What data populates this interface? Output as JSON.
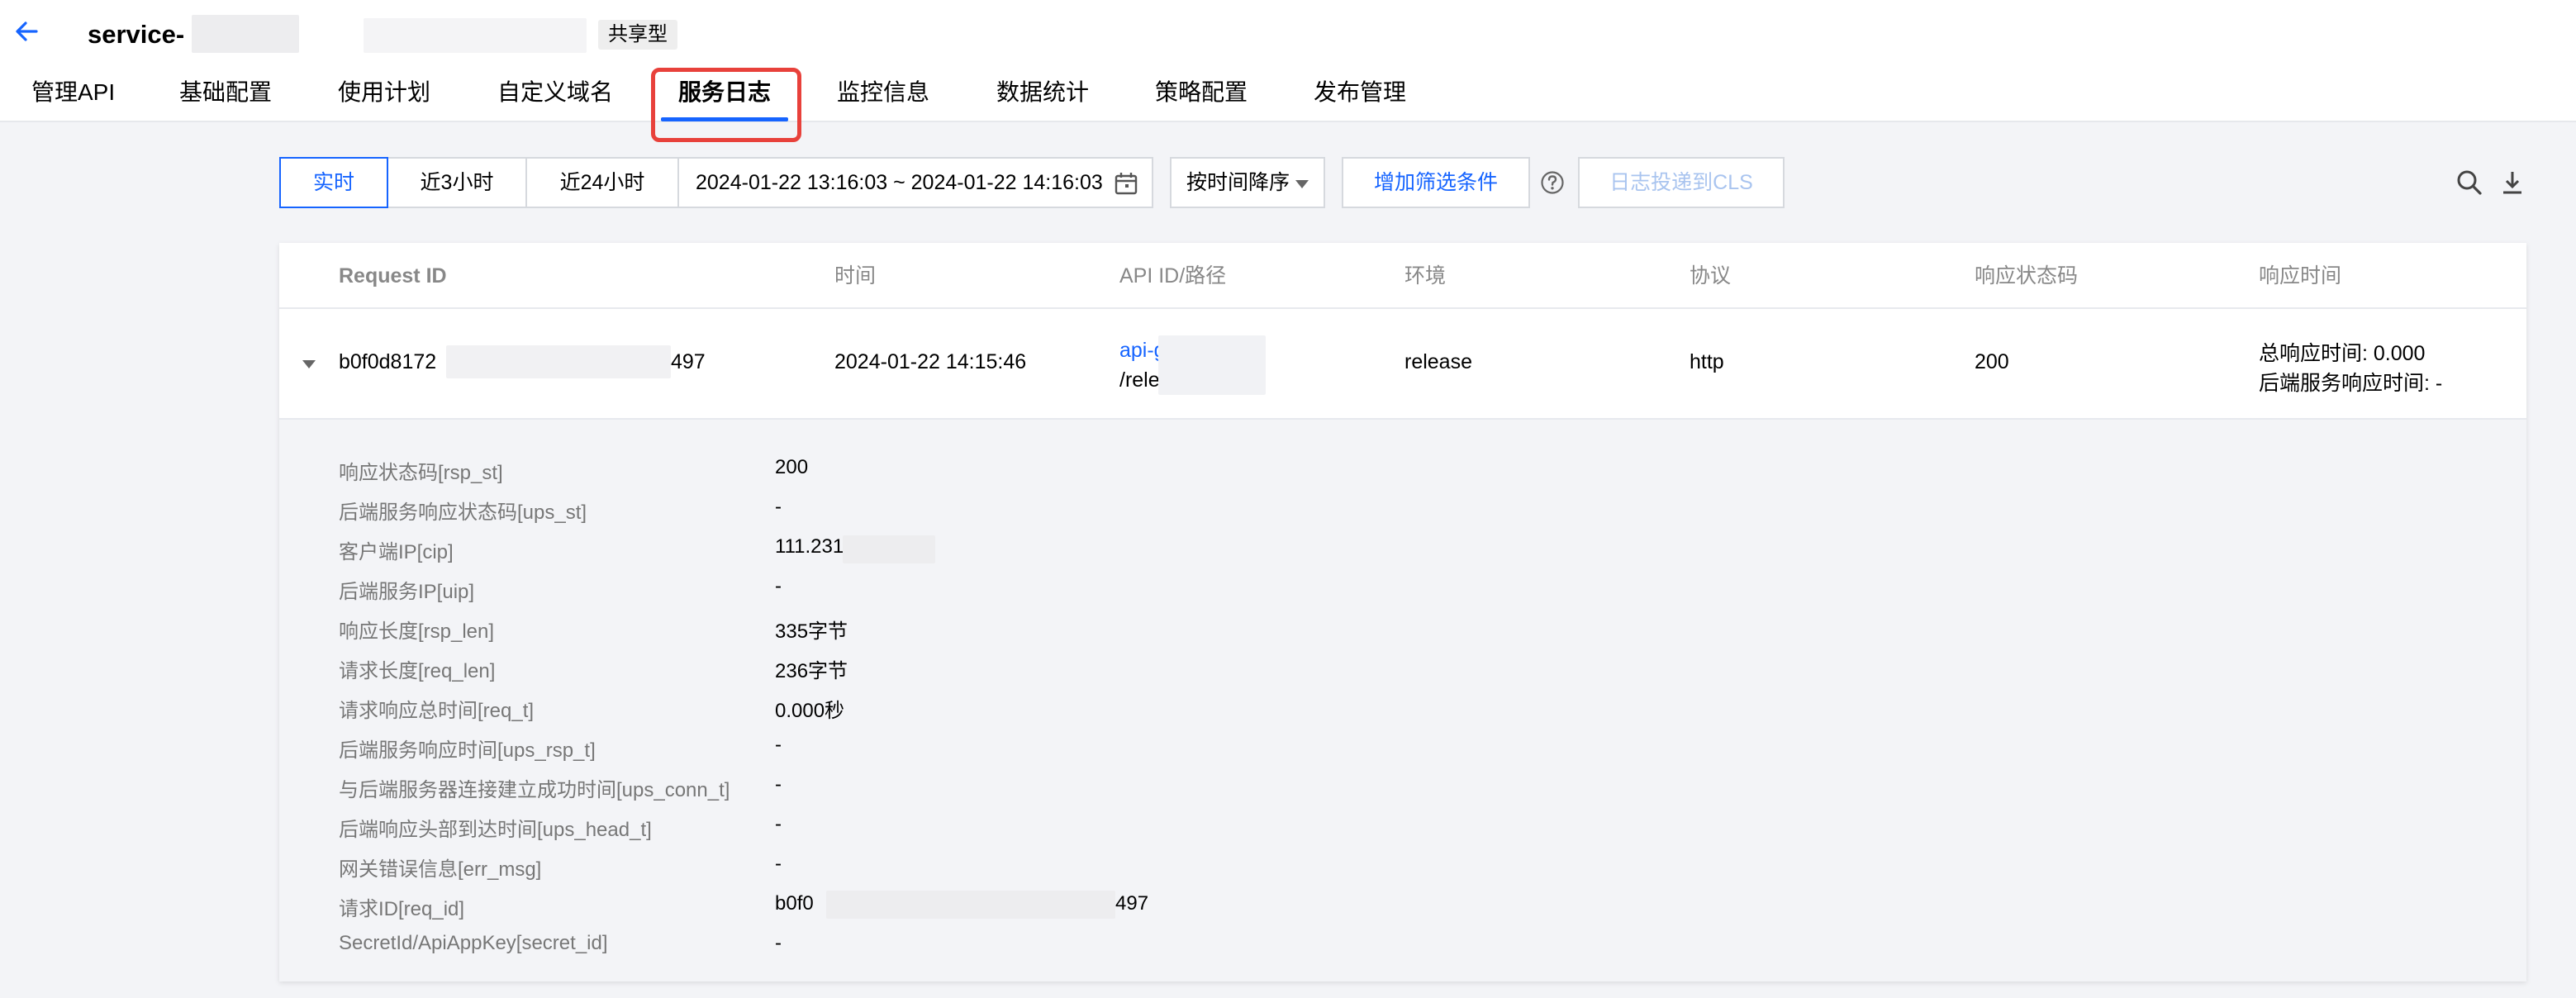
{
  "header": {
    "service_title": "service-",
    "badge": "共享型"
  },
  "tabs": [
    {
      "label": "管理API",
      "active": false
    },
    {
      "label": "基础配置",
      "active": false
    },
    {
      "label": "使用计划",
      "active": false
    },
    {
      "label": "自定义域名",
      "active": false
    },
    {
      "label": "服务日志",
      "active": true
    },
    {
      "label": "监控信息",
      "active": false
    },
    {
      "label": "数据统计",
      "active": false
    },
    {
      "label": "策略配置",
      "active": false
    },
    {
      "label": "发布管理",
      "active": false
    }
  ],
  "toolbar": {
    "time_ranges": [
      {
        "label": "实时",
        "active": true
      },
      {
        "label": "近3小时",
        "active": false
      },
      {
        "label": "近24小时",
        "active": false
      }
    ],
    "date_range": "2024-01-22 13:16:03 ~ 2024-01-22 14:16:03",
    "sort_select": "按时间降序",
    "add_filter_label": "增加筛选条件",
    "ship_to_cls_label": "日志投递到CLS",
    "icons": {
      "help": "help-circle-icon",
      "search": "search-icon",
      "download": "download-icon",
      "calendar": "calendar-icon"
    }
  },
  "table": {
    "columns": [
      "Request ID",
      "时间",
      "API ID/路径",
      "环境",
      "协议",
      "响应状态码",
      "响应时间"
    ],
    "row": {
      "request_id_prefix": "b0f0d8172",
      "request_id_suffix": "497",
      "time": "2024-01-22 14:15:46",
      "api_id": "api-g",
      "api_path": "/relea",
      "environment": "release",
      "protocol": "http",
      "status_code": "200",
      "total_response_time": "总响应时间: 0.000",
      "backend_response_time": "后端服务响应时间: -"
    },
    "details": [
      {
        "label": "响应状态码[rsp_st]",
        "value": "200"
      },
      {
        "label": "后端服务响应状态码[ups_st]",
        "value": "-"
      },
      {
        "label": "客户端IP[cip]",
        "value": "111.231."
      },
      {
        "label": "后端服务IP[uip]",
        "value": "-"
      },
      {
        "label": "响应长度[rsp_len]",
        "value": "335字节"
      },
      {
        "label": "请求长度[req_len]",
        "value": "236字节"
      },
      {
        "label": "请求响应总时间[req_t]",
        "value": "0.000秒"
      },
      {
        "label": "后端服务响应时间[ups_rsp_t]",
        "value": "-"
      },
      {
        "label": "与后端服务器连接建立成功时间[ups_conn_t]",
        "value": "-"
      },
      {
        "label": "后端响应头部到达时间[ups_head_t]",
        "value": "-"
      },
      {
        "label": "网关错误信息[err_msg]",
        "value": "-"
      },
      {
        "label": "请求ID[req_id]",
        "value": "b0f0",
        "value_suffix": "497"
      },
      {
        "label": "SecretId/ApiAppKey[secret_id]",
        "value": "-"
      }
    ]
  },
  "colors": {
    "accent": "#1664ff",
    "highlight": "#e8413b",
    "page_bg": "#f3f4f7"
  }
}
